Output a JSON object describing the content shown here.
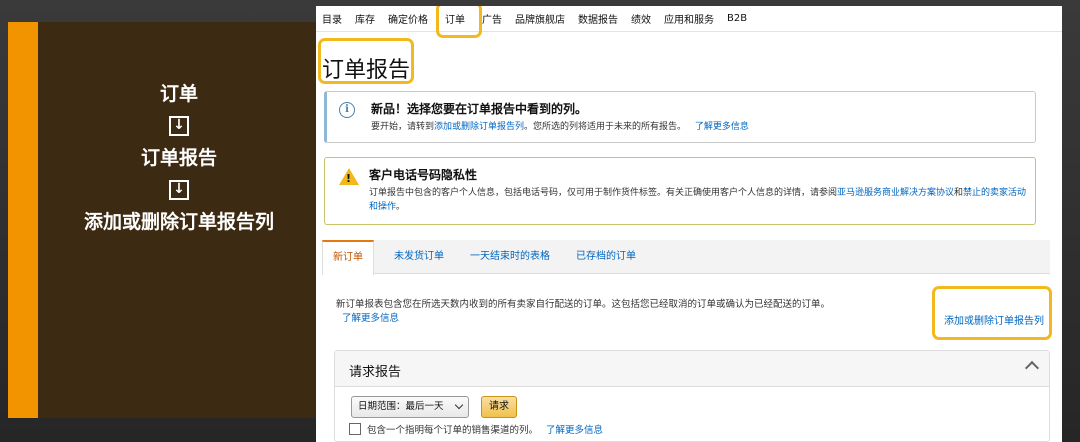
{
  "guide": {
    "step1": "订单",
    "arrow": "↓",
    "step2": "订单报告",
    "step3": "添加或删除订单报告列",
    "accent": "#f19400"
  },
  "nav": {
    "items": [
      "目录",
      "库存",
      "确定价格",
      "订单",
      "广告",
      "品牌旗舰店",
      "数据报告",
      "绩效",
      "应用和服务",
      "B2B"
    ],
    "highlighted": "订单"
  },
  "page_title": "订单报告",
  "notice_info": {
    "icon": "info-icon",
    "title": "新品！选择您要在订单报告中看到的列。",
    "body_prefix": "要开始，请转到",
    "body_link": "添加或删除订单报告列",
    "body_suffix": "。您所选的列将适用于未来的所有报告。",
    "learn_more": "了解更多信息"
  },
  "notice_warn": {
    "icon": "warning-icon",
    "title": "客户电话号码隐私性",
    "body_prefix": "订单报告中包含的客户个人信息，包括电话号码，仅可用于制作货件标签。有关正确使用客户个人信息的详情，请参阅",
    "body_link1": "亚马逊服务商业解决方案协议",
    "body_mid": "和",
    "body_link2": "禁止的卖家活动和操作",
    "body_suffix": "。"
  },
  "tabs": [
    "新订单",
    "未发货订单",
    "一天结束时的表格",
    "已存档的订单"
  ],
  "description": {
    "text": "新订单报表包含您在所选天数内收到的所有卖家自行配送的订单。这包括您已经取消的订单或确认为已经配送的订单。",
    "learn_more": "了解更多信息"
  },
  "add_remove_link": "添加或删除订单报告列",
  "request_report": {
    "title": "请求报告",
    "date_range": "日期范围：最后一天",
    "request_button": "请求",
    "checkbox_label": "包含一个指明每个订单的销售渠道的列。",
    "learn_more": "了解更多信息"
  },
  "highlight_color": "#f2b81e"
}
